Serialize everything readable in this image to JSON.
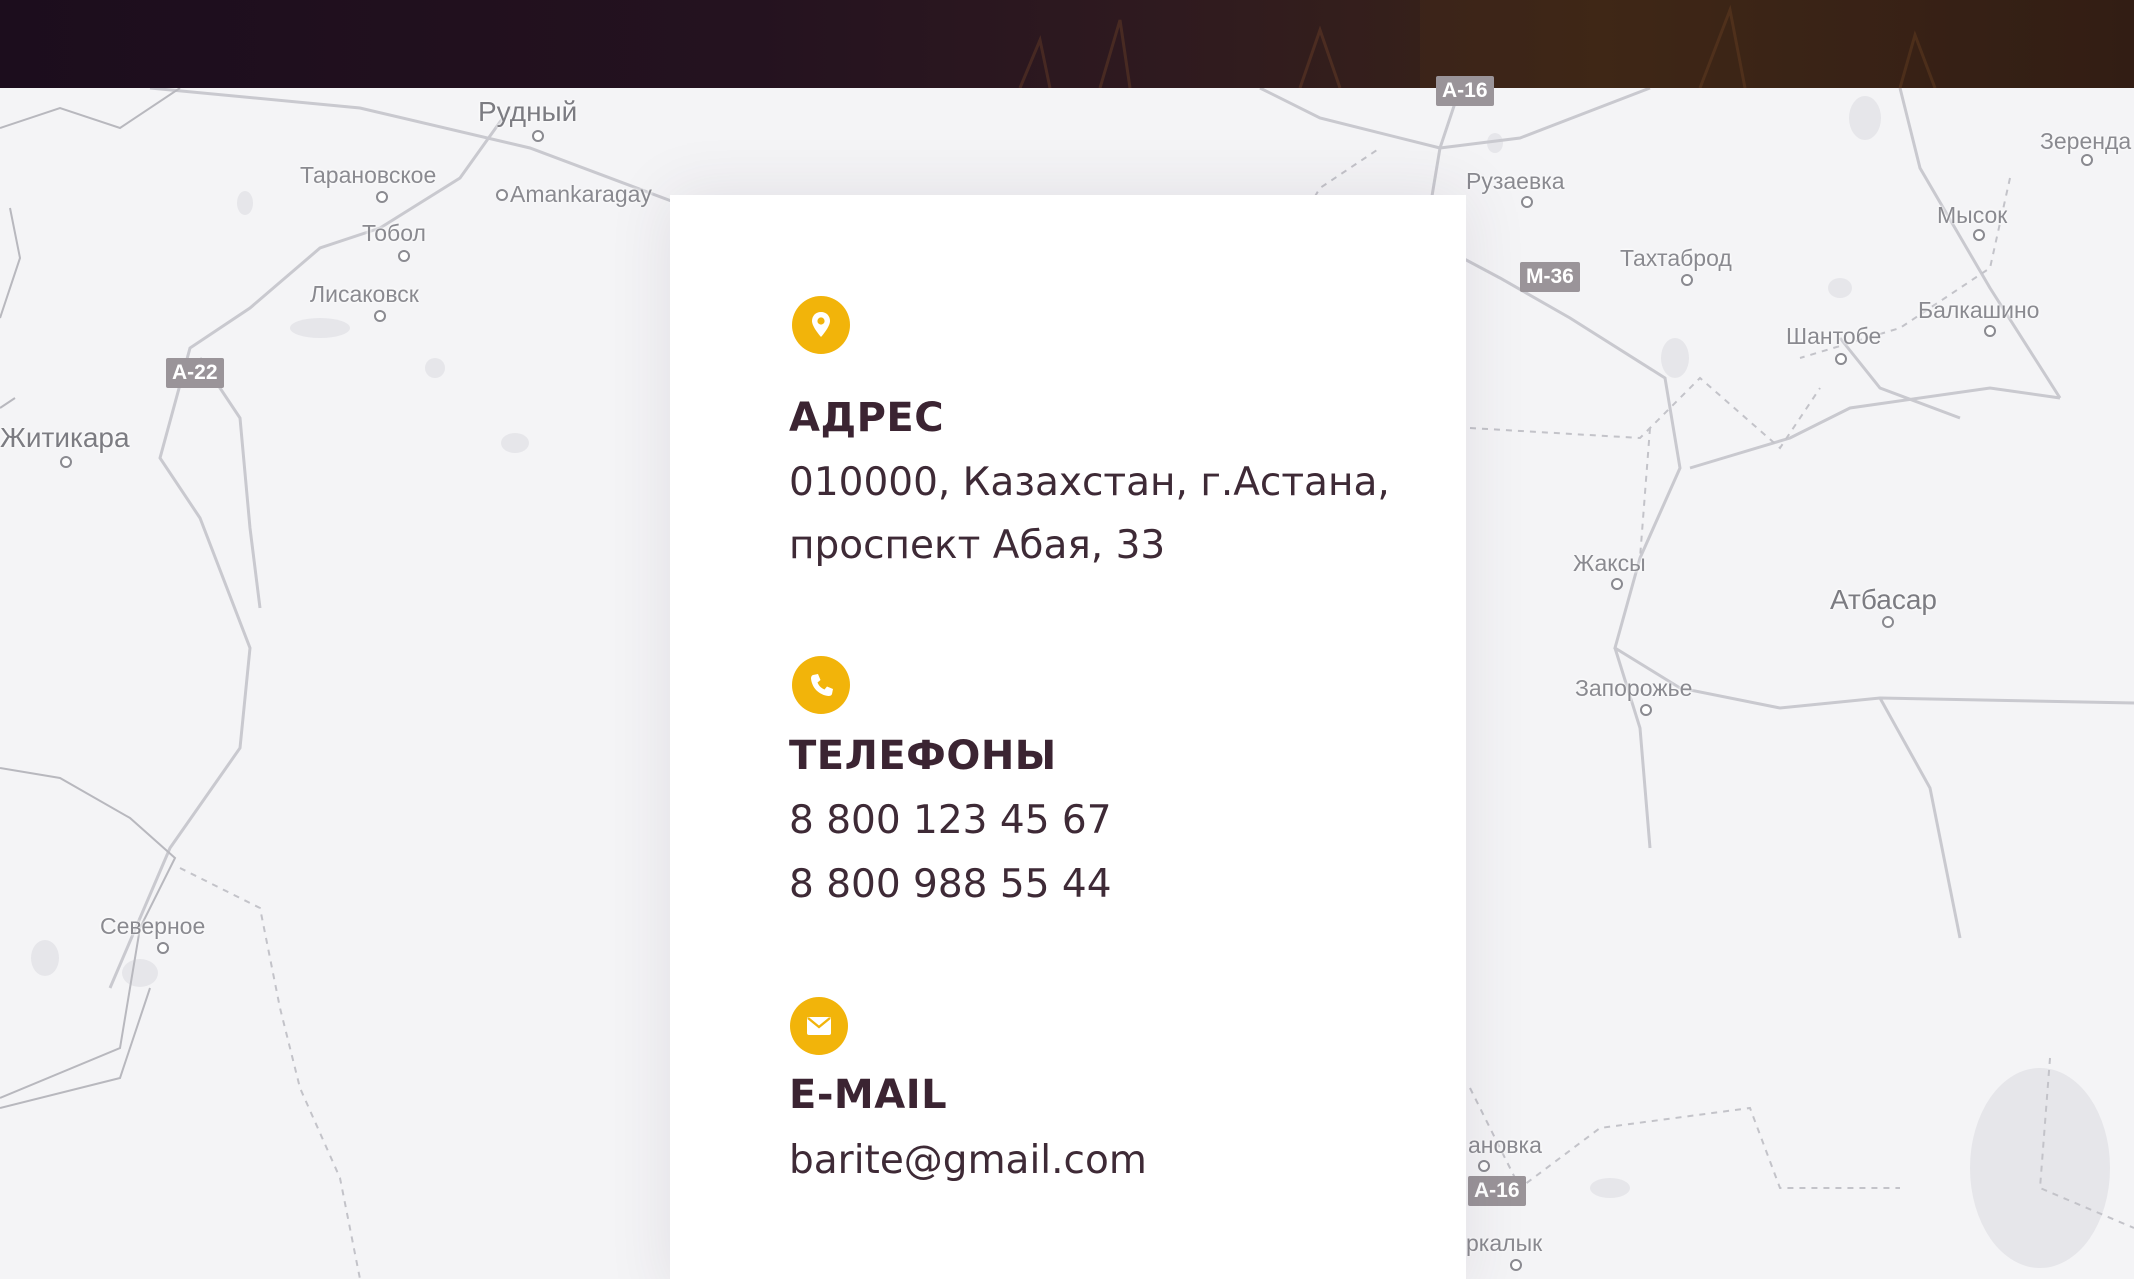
{
  "map": {
    "places": [
      {
        "name": "Рудный"
      },
      {
        "name": "Тарановское"
      },
      {
        "name": "Amankaragay"
      },
      {
        "name": "Тобол"
      },
      {
        "name": "Лисаковск"
      },
      {
        "name": "Житикара"
      },
      {
        "name": "Северное"
      },
      {
        "name": "Рузаевка"
      },
      {
        "name": "Зеренда"
      },
      {
        "name": "Мысок"
      },
      {
        "name": "Тахтаброд"
      },
      {
        "name": "Балкашино"
      },
      {
        "name": "Шантобе"
      },
      {
        "name": "Жаксы"
      },
      {
        "name": "Атбасар"
      },
      {
        "name": "Запорожье"
      },
      {
        "name": "ановка"
      },
      {
        "name": "ркалык"
      }
    ],
    "roads": [
      {
        "label": "A-22"
      },
      {
        "label": "M-36"
      },
      {
        "label": "A-16"
      },
      {
        "label": "A-16"
      }
    ]
  },
  "contacts": {
    "address": {
      "icon": "map-pin-icon",
      "title": "АДРЕС",
      "lines": [
        "010000, Казахстан, г.Астана,",
        "проспект Абая, 33"
      ]
    },
    "phones": {
      "icon": "phone-icon",
      "title": "ТЕЛЕФОНЫ",
      "lines": [
        "8 800 123 45 67",
        "8 800 988 55 44"
      ]
    },
    "email": {
      "icon": "envelope-icon",
      "title": "E-MAIL",
      "lines": [
        "barite@gmail.com"
      ]
    },
    "accent_color": "#f2b40a",
    "text_color": "#3b2432"
  }
}
